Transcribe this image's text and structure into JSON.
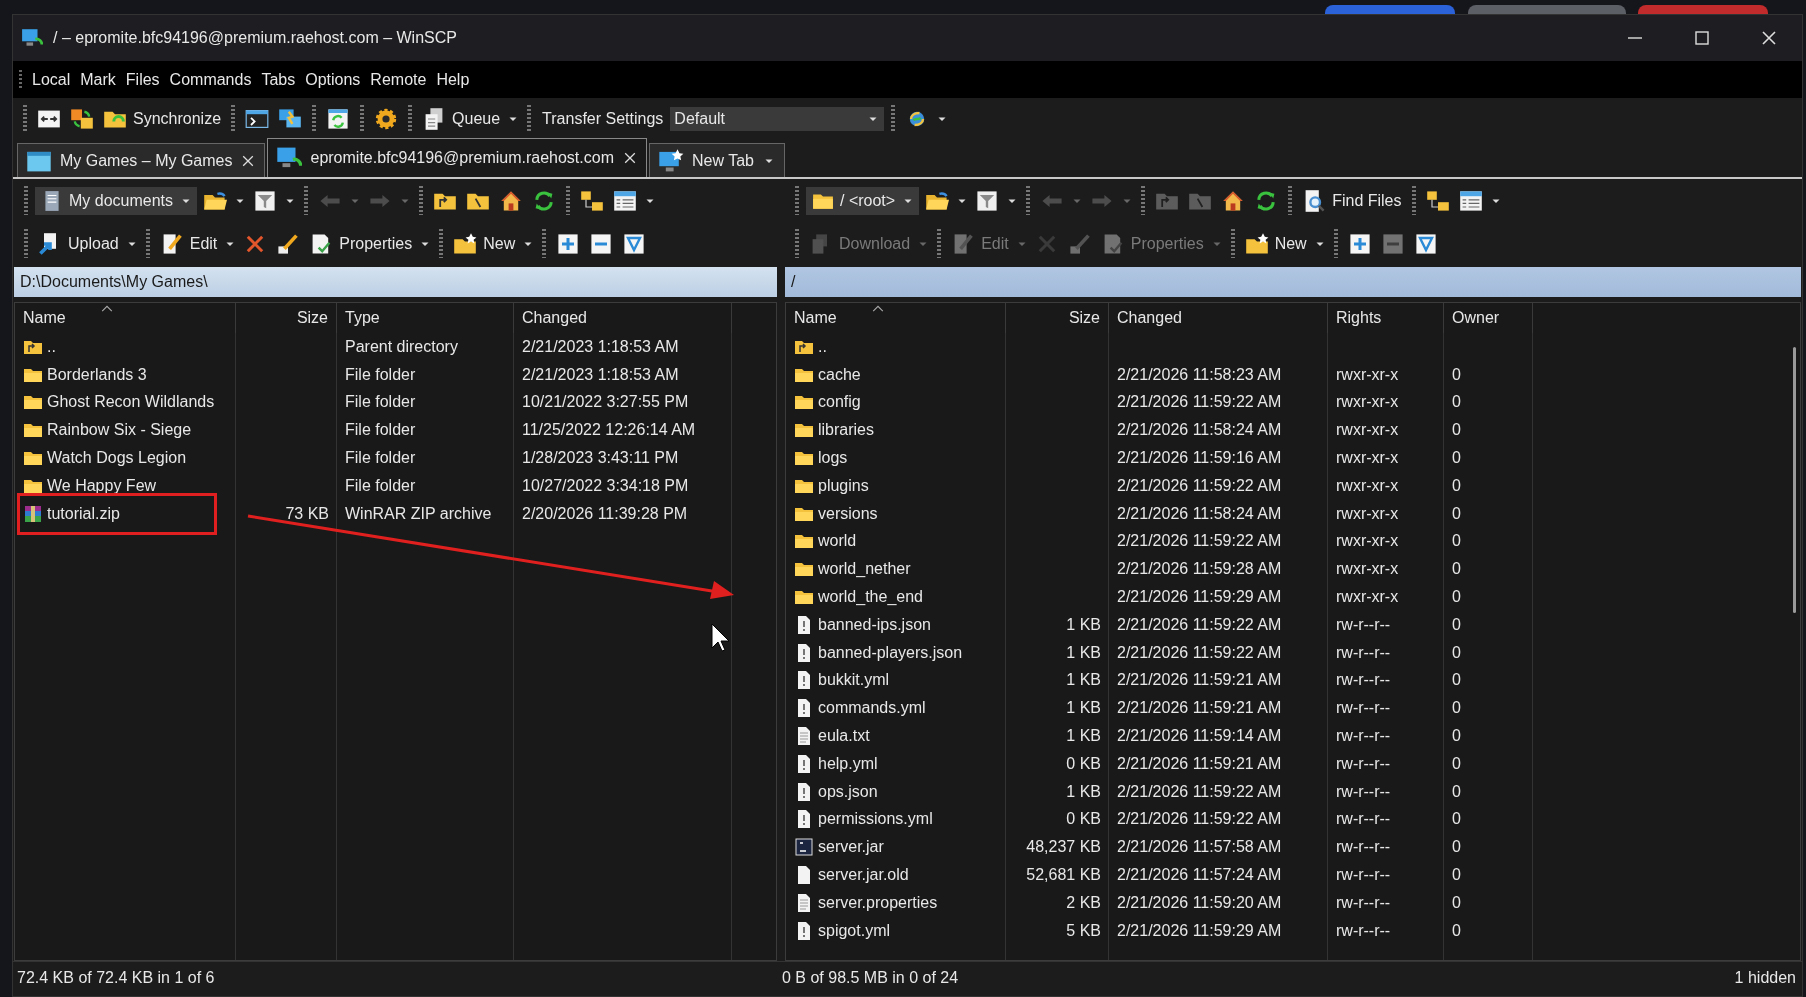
{
  "window": {
    "title": "/ – epromite.bfc94196@premium.raehost.com – WinSCP"
  },
  "menu": [
    "Local",
    "Mark",
    "Files",
    "Commands",
    "Tabs",
    "Options",
    "Remote",
    "Help"
  ],
  "toolbar": [
    {
      "kind": "separator"
    },
    {
      "kind": "icon",
      "dropdown": false,
      "disabled": false
    },
    {
      "kind": "icon",
      "dropdown": false,
      "disabled": false
    },
    {
      "kind": "button",
      "label": "Synchronize",
      "dropdown": false,
      "disabled": false
    },
    {
      "kind": "separator"
    },
    {
      "kind": "icon",
      "dropdown": false,
      "disabled": false
    },
    {
      "kind": "icon",
      "dropdown": false,
      "disabled": false
    },
    {
      "kind": "separator"
    },
    {
      "kind": "icon",
      "dropdown": false,
      "disabled": false
    },
    {
      "kind": "separator"
    },
    {
      "kind": "icon",
      "dropdown": false,
      "disabled": false
    },
    {
      "kind": "separator"
    },
    {
      "kind": "button",
      "label": "Queue",
      "dropdown": true,
      "disabled": false
    },
    {
      "kind": "separator"
    },
    {
      "kind": "label",
      "label": "Transfer Settings"
    },
    {
      "kind": "select",
      "value": "Default"
    },
    {
      "kind": "separator"
    },
    {
      "kind": "icon",
      "dropdown": true,
      "disabled": false
    }
  ],
  "tabs": [
    {
      "label": "My Games – My Games",
      "selected": false,
      "kind": "local"
    },
    {
      "label": "epromite.bfc94196@premium.raehost.com",
      "selected": true,
      "kind": "remote"
    },
    {
      "label": "New Tab",
      "selected": false,
      "kind": "new"
    }
  ],
  "panels": [
    {
      "toolbar_1": [
        {
          "kind": "separator"
        },
        {
          "kind": "combo",
          "value": "My documents"
        },
        {
          "kind": "icon",
          "dropdown": true,
          "disabled": false
        },
        {
          "kind": "icon",
          "dropdown": true,
          "disabled": false
        },
        {
          "kind": "separator"
        },
        {
          "kind": "icon",
          "dropdown": true,
          "disabled": true
        },
        {
          "kind": "icon",
          "dropdown": true,
          "disabled": true
        },
        {
          "kind": "separator"
        },
        {
          "kind": "icon",
          "dropdown": false,
          "disabled": false
        },
        {
          "kind": "icon",
          "dropdown": false,
          "disabled": false
        },
        {
          "kind": "icon",
          "dropdown": false,
          "disabled": false
        },
        {
          "kind": "icon",
          "dropdown": false,
          "disabled": false
        },
        {
          "kind": "separator"
        },
        {
          "kind": "icon",
          "dropdown": false,
          "disabled": false
        },
        {
          "kind": "icon",
          "dropdown": true,
          "disabled": false
        }
      ],
      "toolbar_2": [
        {
          "kind": "separator"
        },
        {
          "kind": "button",
          "label": "Upload",
          "dropdown": true,
          "disabled": false
        },
        {
          "kind": "separator"
        },
        {
          "kind": "button",
          "label": "Edit",
          "dropdown": true,
          "disabled": false
        },
        {
          "kind": "icon",
          "dropdown": false,
          "disabled": false
        },
        {
          "kind": "icon",
          "dropdown": false,
          "disabled": false
        },
        {
          "kind": "button",
          "label": "Properties",
          "dropdown": true,
          "disabled": false
        },
        {
          "kind": "separator"
        },
        {
          "kind": "button",
          "label": "New",
          "dropdown": true,
          "disabled": false
        },
        {
          "kind": "separator"
        },
        {
          "kind": "icon",
          "dropdown": false,
          "disabled": false
        },
        {
          "kind": "icon",
          "dropdown": false,
          "disabled": false
        },
        {
          "kind": "icon",
          "dropdown": false,
          "disabled": false
        }
      ],
      "path": "D:\\Documents\\My Games\\",
      "columns": [
        {
          "label": "Name",
          "kind": "text",
          "sorted": true
        },
        {
          "label": "Size",
          "kind": "size",
          "sorted": false
        },
        {
          "label": "Type",
          "kind": "text",
          "sorted": false
        },
        {
          "label": "Changed",
          "kind": "text",
          "sorted": false
        }
      ],
      "rows": [
        {
          "kind": "parent",
          "highlighted": false,
          "cells": [
            "..",
            null,
            "Parent directory",
            "2/21/2023 1:18:53 AM"
          ]
        },
        {
          "kind": "folder",
          "highlighted": false,
          "cells": [
            "Borderlands 3",
            null,
            "File folder",
            "2/21/2023 1:18:53 AM"
          ]
        },
        {
          "kind": "folder",
          "highlighted": false,
          "cells": [
            "Ghost Recon Wildlands",
            null,
            "File folder",
            "10/21/2022 3:27:55 PM"
          ]
        },
        {
          "kind": "folder",
          "highlighted": false,
          "cells": [
            "Rainbow Six - Siege",
            null,
            "File folder",
            "11/25/2022 12:26:14 AM"
          ]
        },
        {
          "kind": "folder",
          "highlighted": false,
          "cells": [
            "Watch Dogs Legion",
            null,
            "File folder",
            "1/28/2023 3:43:11 PM"
          ]
        },
        {
          "kind": "folder",
          "highlighted": false,
          "cells": [
            "We Happy Few",
            null,
            "File folder",
            "10/27/2022 3:34:18 PM"
          ]
        },
        {
          "kind": "archive",
          "highlighted": true,
          "cells": [
            "tutorial.zip",
            "73 KB",
            "WinRAR ZIP archive",
            "2/20/2026 11:39:28 PM"
          ]
        }
      ],
      "status": "72.4 KB of 72.4 KB in 1 of 6"
    },
    {
      "toolbar_1": [
        {
          "kind": "separator"
        },
        {
          "kind": "combo",
          "value": "/ <root>"
        },
        {
          "kind": "icon",
          "dropdown": true,
          "disabled": false
        },
        {
          "kind": "icon",
          "dropdown": true,
          "disabled": false
        },
        {
          "kind": "separator"
        },
        {
          "kind": "icon",
          "dropdown": true,
          "disabled": true
        },
        {
          "kind": "icon",
          "dropdown": true,
          "disabled": true
        },
        {
          "kind": "separator"
        },
        {
          "kind": "icon",
          "dropdown": false,
          "disabled": true
        },
        {
          "kind": "icon",
          "dropdown": false,
          "disabled": true
        },
        {
          "kind": "icon",
          "dropdown": false,
          "disabled": false
        },
        {
          "kind": "icon",
          "dropdown": false,
          "disabled": false
        },
        {
          "kind": "separator"
        },
        {
          "kind": "button",
          "label": "Find Files",
          "dropdown": false,
          "disabled": false
        },
        {
          "kind": "separator"
        },
        {
          "kind": "icon",
          "dropdown": false,
          "disabled": false
        },
        {
          "kind": "icon",
          "dropdown": true,
          "disabled": false
        }
      ],
      "toolbar_2": [
        {
          "kind": "separator"
        },
        {
          "kind": "button",
          "label": "Download",
          "dropdown": true,
          "disabled": true
        },
        {
          "kind": "separator"
        },
        {
          "kind": "button",
          "label": "Edit",
          "dropdown": true,
          "disabled": true
        },
        {
          "kind": "icon",
          "dropdown": false,
          "disabled": true
        },
        {
          "kind": "icon",
          "dropdown": false,
          "disabled": true
        },
        {
          "kind": "button",
          "label": "Properties",
          "dropdown": true,
          "disabled": true
        },
        {
          "kind": "separator"
        },
        {
          "kind": "button",
          "label": "New",
          "dropdown": true,
          "disabled": false
        },
        {
          "kind": "separator"
        },
        {
          "kind": "icon",
          "dropdown": false,
          "disabled": false
        },
        {
          "kind": "icon",
          "dropdown": false,
          "disabled": true
        },
        {
          "kind": "icon",
          "dropdown": false,
          "disabled": false
        }
      ],
      "path": "/",
      "columns": [
        {
          "label": "Name",
          "kind": "text",
          "sorted": true
        },
        {
          "label": "Size",
          "kind": "size",
          "sorted": false
        },
        {
          "label": "Changed",
          "kind": "text",
          "sorted": false
        },
        {
          "label": "Rights",
          "kind": "text",
          "sorted": false
        },
        {
          "label": "Owner",
          "kind": "text",
          "sorted": false
        }
      ],
      "rows": [
        {
          "kind": "parent",
          "highlighted": false,
          "cells": [
            "..",
            null,
            null,
            null,
            null
          ]
        },
        {
          "kind": "folder",
          "highlighted": false,
          "cells": [
            "cache",
            null,
            "2/21/2026 11:58:23 AM",
            "rwxr-xr-x",
            "0"
          ]
        },
        {
          "kind": "folder",
          "highlighted": false,
          "cells": [
            "config",
            null,
            "2/21/2026 11:59:22 AM",
            "rwxr-xr-x",
            "0"
          ]
        },
        {
          "kind": "folder",
          "highlighted": false,
          "cells": [
            "libraries",
            null,
            "2/21/2026 11:58:24 AM",
            "rwxr-xr-x",
            "0"
          ]
        },
        {
          "kind": "folder",
          "highlighted": false,
          "cells": [
            "logs",
            null,
            "2/21/2026 11:59:16 AM",
            "rwxr-xr-x",
            "0"
          ]
        },
        {
          "kind": "folder",
          "highlighted": false,
          "cells": [
            "plugins",
            null,
            "2/21/2026 11:59:22 AM",
            "rwxr-xr-x",
            "0"
          ]
        },
        {
          "kind": "folder",
          "highlighted": false,
          "cells": [
            "versions",
            null,
            "2/21/2026 11:58:24 AM",
            "rwxr-xr-x",
            "0"
          ]
        },
        {
          "kind": "folder",
          "highlighted": false,
          "cells": [
            "world",
            null,
            "2/21/2026 11:59:22 AM",
            "rwxr-xr-x",
            "0"
          ]
        },
        {
          "kind": "folder",
          "highlighted": false,
          "cells": [
            "world_nether",
            null,
            "2/21/2026 11:59:28 AM",
            "rwxr-xr-x",
            "0"
          ]
        },
        {
          "kind": "folder",
          "highlighted": false,
          "cells": [
            "world_the_end",
            null,
            "2/21/2026 11:59:29 AM",
            "rwxr-xr-x",
            "0"
          ]
        },
        {
          "kind": "config",
          "highlighted": false,
          "cells": [
            "banned-ips.json",
            "1 KB",
            "2/21/2026 11:59:22 AM",
            "rw-r--r--",
            "0"
          ]
        },
        {
          "kind": "config",
          "highlighted": false,
          "cells": [
            "banned-players.json",
            "1 KB",
            "2/21/2026 11:59:22 AM",
            "rw-r--r--",
            "0"
          ]
        },
        {
          "kind": "config",
          "highlighted": false,
          "cells": [
            "bukkit.yml",
            "1 KB",
            "2/21/2026 11:59:21 AM",
            "rw-r--r--",
            "0"
          ]
        },
        {
          "kind": "config",
          "highlighted": false,
          "cells": [
            "commands.yml",
            "1 KB",
            "2/21/2026 11:59:21 AM",
            "rw-r--r--",
            "0"
          ]
        },
        {
          "kind": "text",
          "highlighted": false,
          "cells": [
            "eula.txt",
            "1 KB",
            "2/21/2026 11:59:14 AM",
            "rw-r--r--",
            "0"
          ]
        },
        {
          "kind": "config",
          "highlighted": false,
          "cells": [
            "help.yml",
            "0 KB",
            "2/21/2026 11:59:21 AM",
            "rw-r--r--",
            "0"
          ]
        },
        {
          "kind": "config",
          "highlighted": false,
          "cells": [
            "ops.json",
            "1 KB",
            "2/21/2026 11:59:22 AM",
            "rw-r--r--",
            "0"
          ]
        },
        {
          "kind": "config",
          "highlighted": false,
          "cells": [
            "permissions.yml",
            "0 KB",
            "2/21/2026 11:59:22 AM",
            "rw-r--r--",
            "0"
          ]
        },
        {
          "kind": "jar",
          "highlighted": false,
          "cells": [
            "server.jar",
            "48,237 KB",
            "2/21/2026 11:57:58 AM",
            "rw-r--r--",
            "0"
          ]
        },
        {
          "kind": "file",
          "highlighted": false,
          "cells": [
            "server.jar.old",
            "52,681 KB",
            "2/21/2026 11:57:24 AM",
            "rw-r--r--",
            "0"
          ]
        },
        {
          "kind": "text",
          "highlighted": false,
          "cells": [
            "server.properties",
            "2 KB",
            "2/21/2026 11:59:20 AM",
            "rw-r--r--",
            "0"
          ]
        },
        {
          "kind": "config",
          "highlighted": false,
          "cells": [
            "spigot.yml",
            "5 KB",
            "2/21/2026 11:59:29 AM",
            "rw-r--r--",
            "0"
          ]
        }
      ],
      "status": "0 B of 98.5 MB in 0 of 24"
    }
  ],
  "status_bar": {
    "hidden": "1 hidden"
  }
}
